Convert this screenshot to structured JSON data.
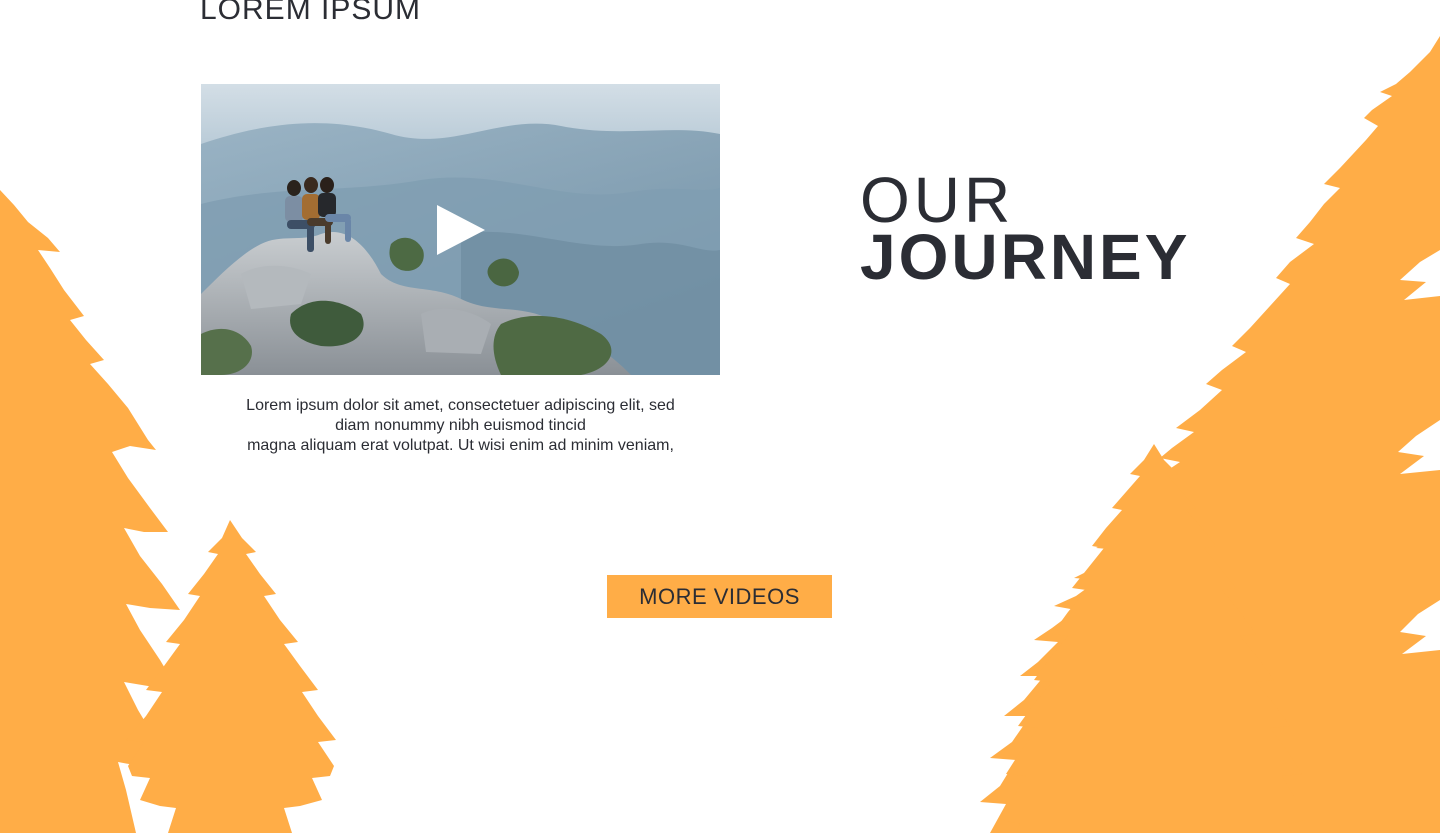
{
  "header": {
    "heading": "LOREM IPSUM"
  },
  "video": {
    "play_icon": "play-icon",
    "thumbnail": "three people sitting on rocky mountain ledge"
  },
  "caption": {
    "line1": "Lorem ipsum dolor sit amet, consectetuer adipiscing elit, sed",
    "line2": "diam nonummy nibh euismod tincid",
    "line3": "magna aliquam erat volutpat. Ut wisi enim ad minim veniam,"
  },
  "journey": {
    "our": "OUR",
    "main": "JOURNEY"
  },
  "cta": {
    "label": "MORE VIDEOS"
  },
  "colors": {
    "accent": "#ffad47",
    "text": "#2b2d34",
    "background": "#ffffff"
  }
}
